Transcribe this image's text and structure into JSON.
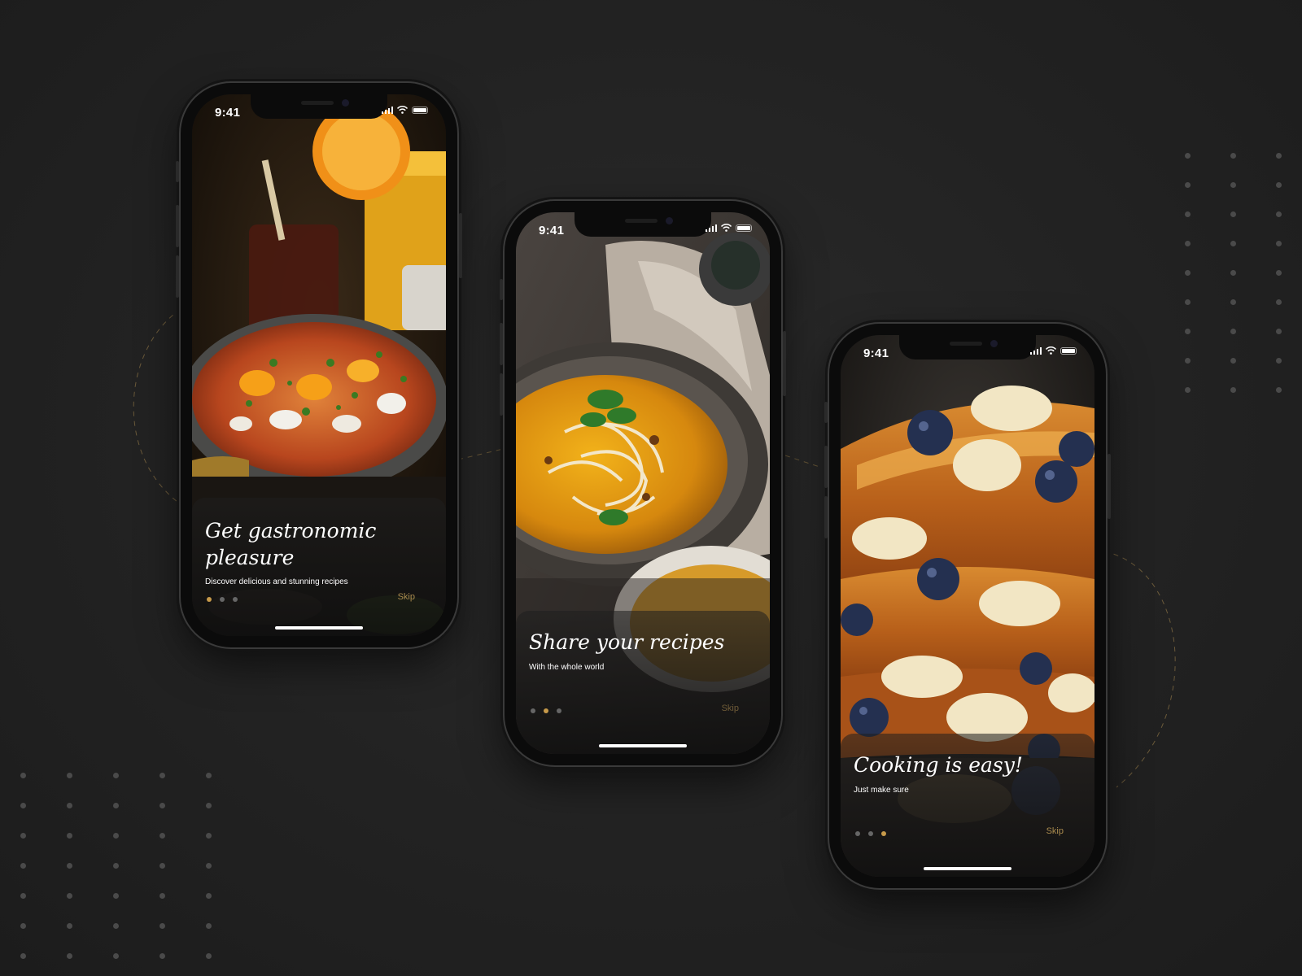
{
  "colors": {
    "background": "#222222",
    "accent": "#c79a4a",
    "skip_text": "#a98a4e"
  },
  "screens": [
    {
      "status": {
        "time": "9:41",
        "icons": [
          "signal-icon",
          "wifi-icon",
          "battery-icon"
        ]
      },
      "title": "Get gastronomic pleasure",
      "subtitle": "Discover delicious and stunning recipes",
      "skip_label": "Skip",
      "page_index": 1,
      "page_count": 3,
      "image": "shakshuka-pan-photo"
    },
    {
      "status": {
        "time": "9:41",
        "icons": [
          "signal-icon",
          "wifi-icon",
          "battery-icon"
        ]
      },
      "title": "Share your recipes",
      "subtitle": "With the whole world",
      "skip_label": "Skip",
      "page_index": 2,
      "page_count": 3,
      "image": "noodle-soup-bowl-photo"
    },
    {
      "status": {
        "time": "9:41",
        "icons": [
          "signal-icon",
          "wifi-icon",
          "battery-icon"
        ]
      },
      "title": "Cooking is easy!",
      "subtitle": "Just make sure",
      "skip_label": "Skip",
      "page_index": 3,
      "page_count": 3,
      "image": "french-toast-blueberries-photo"
    }
  ]
}
